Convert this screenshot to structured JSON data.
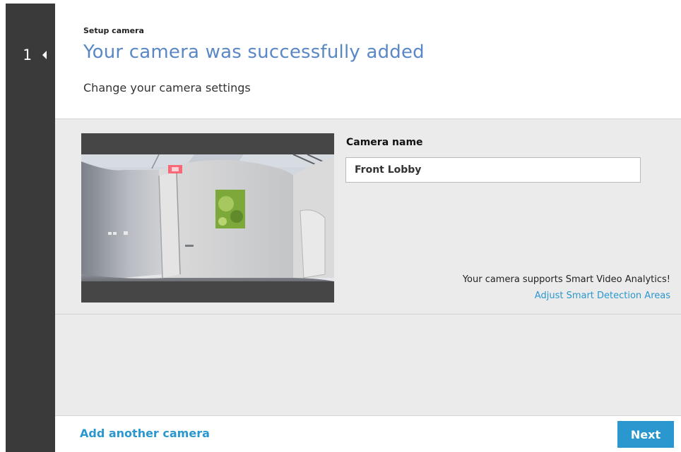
{
  "wizard": {
    "step_number": "1"
  },
  "header": {
    "eyebrow": "Setup camera",
    "title": "Your camera was successfully added",
    "subtitle": "Change your camera settings"
  },
  "settings": {
    "camera_name_label": "Camera name",
    "camera_name_value": "Front Lobby",
    "smart_analytics_text": "Your camera supports Smart Video Analytics!",
    "smart_analytics_link": "Adjust Smart Detection Areas"
  },
  "footer": {
    "add_camera_label": "Add another camera",
    "next_label": "Next"
  },
  "colors": {
    "accent": "#2a97cf",
    "title": "#5a88c6",
    "rail": "#3a3a3a",
    "panel": "#ebebeb"
  }
}
